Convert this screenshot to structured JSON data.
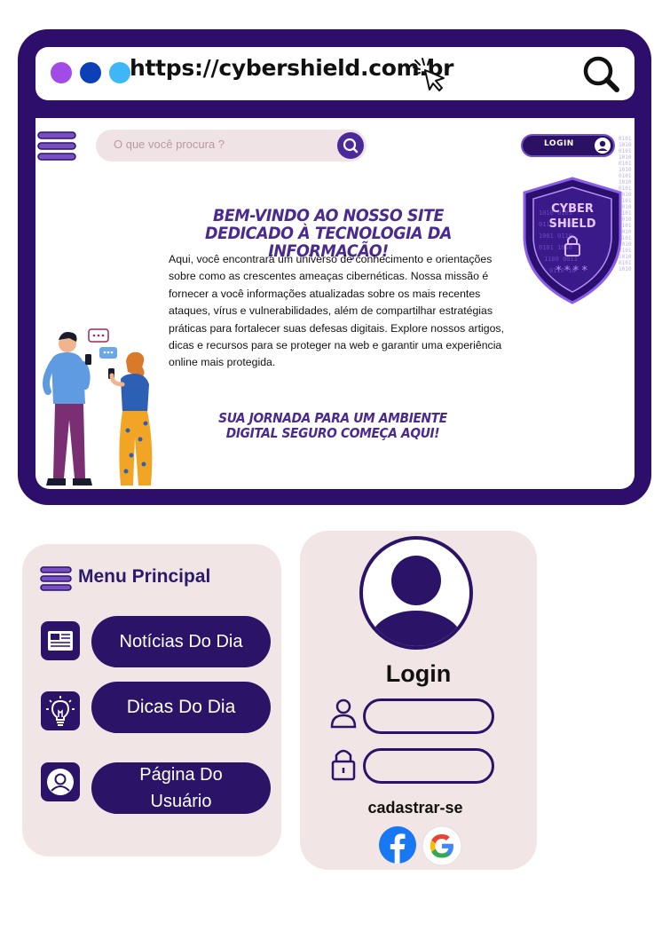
{
  "browser": {
    "url": "https://cybershield.com.br",
    "dot_colors": [
      "#a24be6",
      "#0d3fb6",
      "#3db7f5"
    ],
    "frame_color": "#2d0f6b"
  },
  "site": {
    "search_placeholder": "O que você procura ?",
    "login_label": "LOGIN",
    "shield_text_line1": "CYBER",
    "shield_text_line2": "SHIELD",
    "shield_password": "****",
    "headline": "BEM-VINDO AO NOSSO SITE DEDICADO À TECNOLOGIA DA INFORMAÇÃO!",
    "body": "Aqui, você encontrará um universo de conhecimento e orientações sobre como  as crescentes ameaças cibernéticas. Nossa missão é fornecer a você informações atualizadas sobre os mais recentes ataques, vírus e vulnerabilidades, além de compartilhar estratégias práticas para fortalecer suas defesas digitais. Explore nossos artigos, dicas e recursos para se proteger na web e garantir uma experiência online mais protegida.",
    "tagline": "SUA JORNADA PARA UM AMBIENTE DIGITAL SEGURO COMEÇA AQUI!",
    "accent": "#4a2a8f"
  },
  "menu": {
    "title": "Menu Principal",
    "items": [
      {
        "label": "Notícias Do Dia",
        "icon": "newspaper-icon"
      },
      {
        "label": "Dicas Do Dia",
        "icon": "lightbulb-icon"
      },
      {
        "label": "Página Do Usuário",
        "icon": "user-icon"
      }
    ],
    "button_color": "#2b1468",
    "card_color": "#f2e5e6"
  },
  "login": {
    "title": "Login",
    "register": "cadastrar-se",
    "social": [
      "facebook-icon",
      "google-icon"
    ]
  }
}
